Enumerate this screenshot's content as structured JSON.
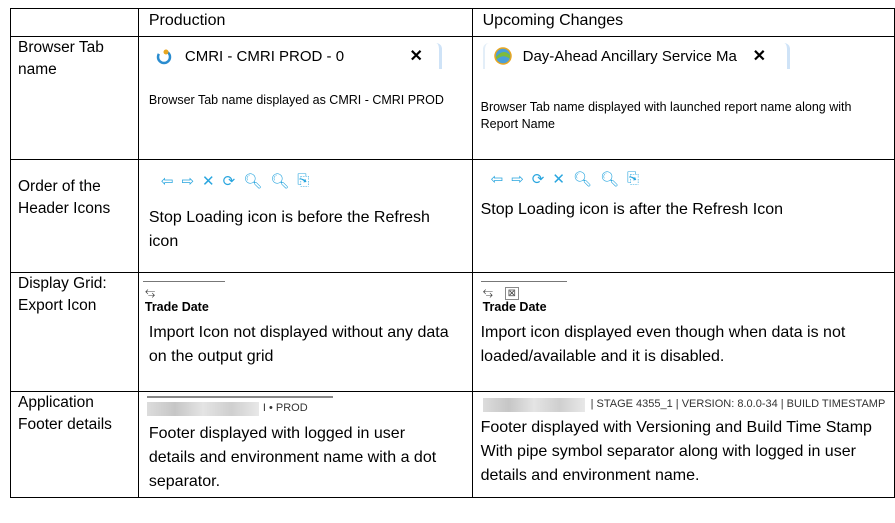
{
  "header": {
    "col1": "",
    "col2": "Production",
    "col3": "Upcoming Changes"
  },
  "rows": {
    "tab": {
      "label": "Browser Tab name",
      "prod_tab_title": "CMRI - CMRI PROD - 0",
      "prod_desc": "Browser Tab name displayed as CMRI - CMRI PROD",
      "up_tab_title": "Day-Ahead Ancillary Service Ma",
      "up_desc": "Browser Tab name displayed with launched report name along with Report Name",
      "close": "✕"
    },
    "icons": {
      "label": "Order of the Header Icons",
      "prod_desc": "Stop Loading icon is before the Refresh icon",
      "up_desc": "Stop Loading icon is after the Refresh Icon"
    },
    "grid": {
      "label": "Display Grid: Export Icon",
      "trade_date": "Trade Date",
      "prod_desc": "Import Icon not displayed without any data on the output grid",
      "up_desc": "Import icon displayed even though when data is not loaded/available and it is disabled."
    },
    "footer": {
      "label": "Application Footer details",
      "prod_footer_text": "I • PROD",
      "prod_desc": "Footer displayed with logged in user details and environment name with a dot separator.",
      "up_footer_text": "| STAGE 4355_1 | VERSION: 8.0.0-34 | BUILD TIMESTAMP",
      "up_desc_1": "Footer displayed with Versioning and Build Time Stamp",
      "up_desc_2": "With pipe symbol separator along with logged in user details and environment name."
    }
  }
}
